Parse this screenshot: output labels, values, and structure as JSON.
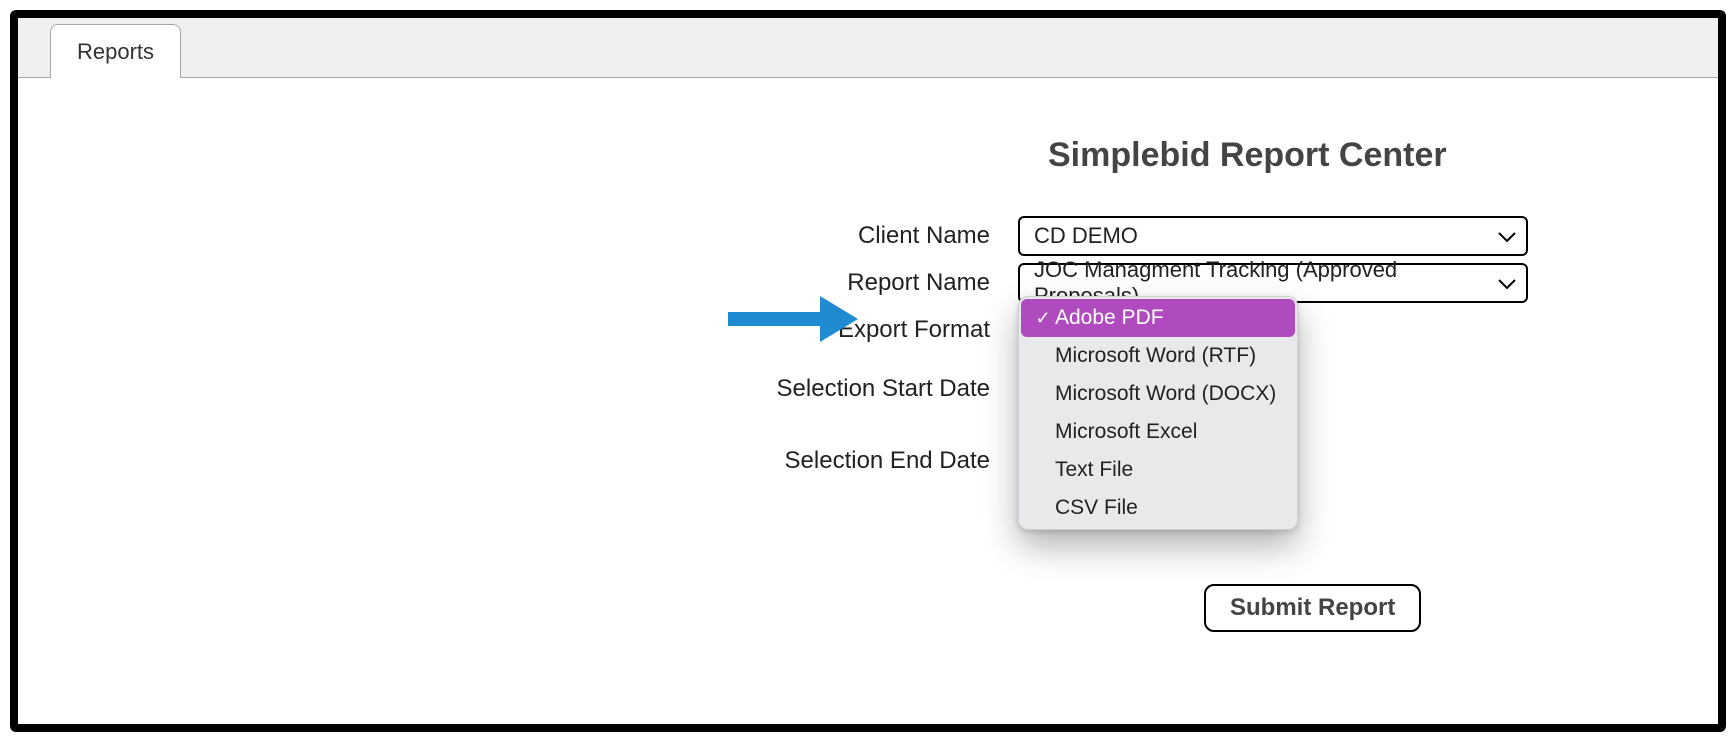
{
  "tab": {
    "label": "Reports"
  },
  "title": "Simplebid Report Center",
  "form": {
    "client": {
      "label": "Client Name",
      "value": "CD DEMO"
    },
    "report": {
      "label": "Report Name",
      "value": "JOC Managment Tracking (Approved Proposals)"
    },
    "format": {
      "label": "Export Format",
      "selected": "Adobe PDF",
      "options": [
        "Adobe PDF",
        "Microsoft Word (RTF)",
        "Microsoft Word (DOCX)",
        "Microsoft Excel",
        "Text File",
        "CSV File"
      ]
    },
    "start": {
      "label": "Selection Start Date"
    },
    "end": {
      "label": "Selection End Date"
    }
  },
  "submit": {
    "label": "Submit Report"
  },
  "colors": {
    "highlight": "#b04bbf",
    "arrow": "#1f8bd1"
  }
}
